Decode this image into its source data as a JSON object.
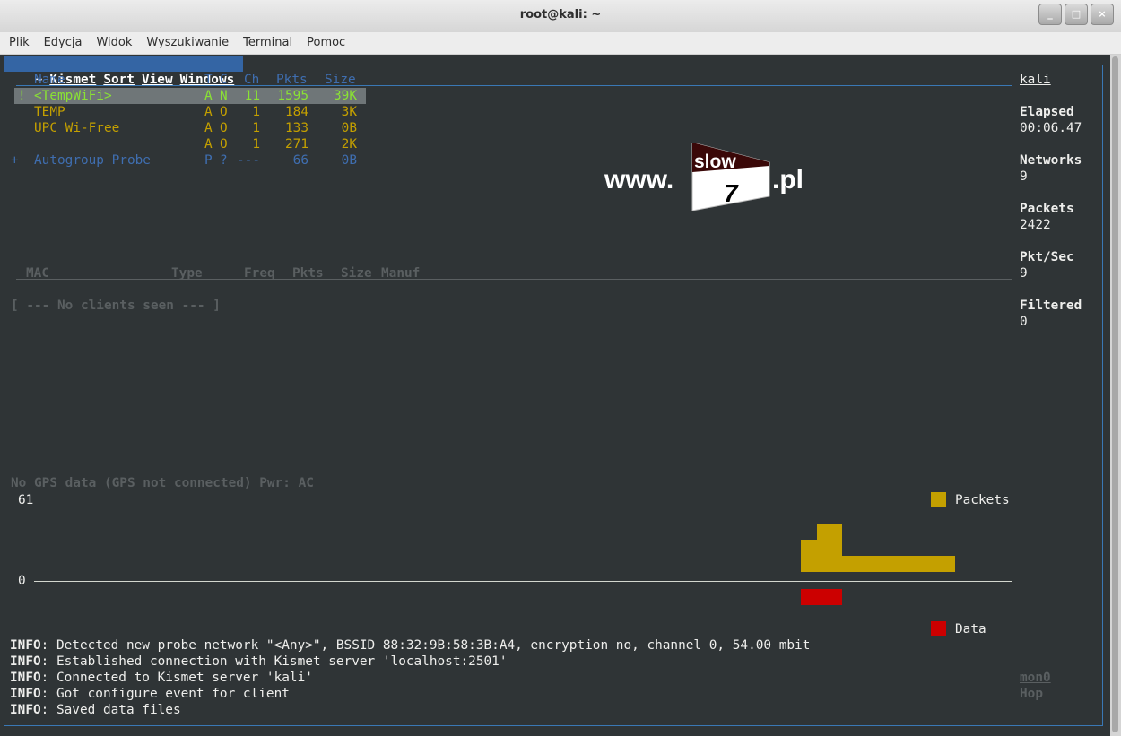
{
  "window": {
    "title": "root@kali: ~",
    "controls": [
      "_",
      "□",
      "×"
    ]
  },
  "menu": [
    "Plik",
    "Edycja",
    "Widok",
    "Wyszukiwanie",
    "Terminal",
    "Pomoc"
  ],
  "kismet_menu": {
    "tilde": "~",
    "items": [
      "Kismet",
      "Sort",
      "View",
      "Windows"
    ]
  },
  "network_list": {
    "headers": {
      "name": "Name",
      "t": "T",
      "c": "C",
      "ch": "Ch",
      "pkts": "Pkts",
      "size": "Size"
    },
    "rows": [
      {
        "flag": "!",
        "name": "<TempWiFi>",
        "t": "A",
        "c": "N",
        "ch": "11",
        "pkts": "1595",
        "size": "39K"
      },
      {
        "flag": "",
        "name": "TEMP",
        "t": "A",
        "c": "O",
        "ch": "1",
        "pkts": "184",
        "size": "3K"
      },
      {
        "flag": "",
        "name": "UPC Wi-Free",
        "t": "A",
        "c": "O",
        "ch": "1",
        "pkts": "133",
        "size": "0B"
      },
      {
        "flag": "",
        "name": "",
        "t": "A",
        "c": "O",
        "ch": "1",
        "pkts": "271",
        "size": "2K"
      },
      {
        "flag": "+",
        "name": "Autogroup Probe",
        "t": "P",
        "c": "?",
        "ch": "---",
        "pkts": "66",
        "size": "0B"
      }
    ]
  },
  "client_list": {
    "headers": {
      "mac": "MAC",
      "type": "Type",
      "freq": "Freq",
      "pkts": "Pkts",
      "size": "Size",
      "manuf": "Manuf"
    },
    "empty": "[ --- No clients seen --- ]"
  },
  "gps_status": "No GPS data (GPS not connected) Pwr: AC",
  "graph": {
    "max_label": "61",
    "zero_label": "0",
    "legend_packets": "Packets",
    "legend_data": "Data",
    "packets_color": "#c4a000",
    "data_color": "#cc0000"
  },
  "info_label": "INFO",
  "info_lines": [
    ": Detected new probe network \"<Any>\", BSSID 88:32:9B:58:3B:A4, encryption no, channel 0, 54.00 mbit",
    ": Established connection with Kismet server 'localhost:2501'",
    ": Connected to Kismet server 'kali'",
    ": Got configure event for client",
    ": Saved data files"
  ],
  "side_panel": {
    "host": "kali",
    "elapsed_label": "Elapsed",
    "elapsed": "00:06.47",
    "networks_label": "Networks",
    "networks": "9",
    "packets_label": "Packets",
    "packets": "2422",
    "pktsec_label": "Pkt/Sec",
    "pktsec": "9",
    "filtered_label": "Filtered",
    "filtered": "0",
    "iface": "mon0",
    "hop": "Hop"
  },
  "watermark": {
    "prefix": "www.",
    "top": "slow",
    "number": "7",
    "suffix": ".pl"
  }
}
